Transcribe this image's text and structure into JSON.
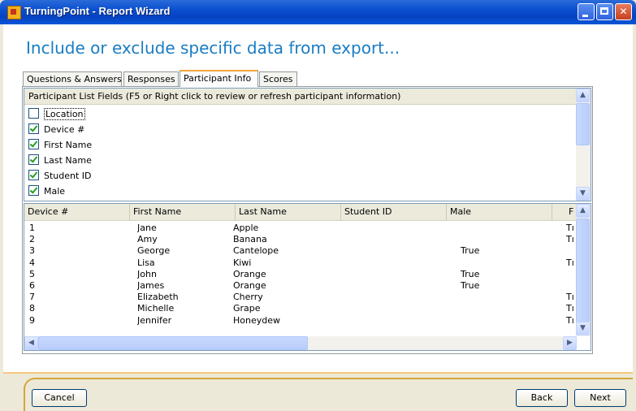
{
  "window": {
    "title": "TurningPoint - Report Wizard",
    "buttons": {
      "minimize": "minimize-icon",
      "maximize": "maximize-icon",
      "close": "close-icon"
    }
  },
  "heading": "Include or exclude specific data from export...",
  "tabs": [
    {
      "label": "Questions & Answers",
      "active": false
    },
    {
      "label": "Responses",
      "active": false
    },
    {
      "label": "Participant Info",
      "active": true
    },
    {
      "label": "Scores",
      "active": false
    }
  ],
  "fields_panel": {
    "header": "Participant List Fields (F5 or Right click to review or refresh participant information)",
    "fields": [
      {
        "label": "Location",
        "checked": false
      },
      {
        "label": "Device #",
        "checked": true
      },
      {
        "label": "First Name",
        "checked": true
      },
      {
        "label": "Last Name",
        "checked": true
      },
      {
        "label": "Student ID",
        "checked": true
      },
      {
        "label": "Male",
        "checked": true
      }
    ]
  },
  "table": {
    "columns": [
      "Device #",
      "First Name",
      "Last Name",
      "Student ID",
      "Male",
      "F"
    ],
    "rows": [
      [
        "1",
        "Jane",
        "Apple",
        "",
        "",
        "Tı"
      ],
      [
        "2",
        "Amy",
        "Banana",
        "",
        "",
        "Tı"
      ],
      [
        "3",
        "George",
        "Cantelope",
        "",
        "True",
        ""
      ],
      [
        "4",
        "Lisa",
        "Kiwi",
        "",
        "",
        "Tı"
      ],
      [
        "5",
        "John",
        "Orange",
        "",
        "True",
        ""
      ],
      [
        "6",
        "James",
        "Orange",
        "",
        "True",
        ""
      ],
      [
        "7",
        "Elizabeth",
        "Cherry",
        "",
        "",
        "Tı"
      ],
      [
        "8",
        "Michelle",
        "Grape",
        "",
        "",
        "Tı"
      ],
      [
        "9",
        "Jennifer",
        "Honeydew",
        "",
        "",
        "Tı"
      ]
    ]
  },
  "footer": {
    "cancel": "Cancel",
    "back": "Back",
    "next": "Next"
  }
}
